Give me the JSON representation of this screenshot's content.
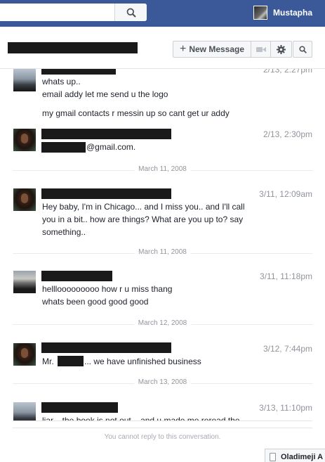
{
  "topbar": {
    "search_placeholder": "",
    "search_icon": "magnifier-icon",
    "user_name": "Mustapha",
    "color": "#3b5998"
  },
  "header": {
    "new_message_label": "New Message",
    "plus_glyph": "+",
    "video_icon": "video-camera-icon",
    "gear_icon": "gear-icon",
    "search_icon": "magnifier-icon"
  },
  "messages": [
    {
      "time": "2/13, 2:27pm",
      "lines": [
        "whats up..",
        "email addy let me send u the logo",
        "my gmail contacts r messin up so cant get ur addy"
      ]
    },
    {
      "time": "2/13, 2:30pm",
      "lines": [
        "@gmail.com."
      ]
    },
    {
      "divider": "March 11, 2008",
      "time": "3/11, 12:09am",
      "lines": [
        "Hey baby, I'm in Chicago... and I miss you.. and I'll call",
        "you in a bit.. how are things? What are you up to? say",
        "something.."
      ]
    },
    {
      "divider": "March 11, 2008",
      "time": "3/11, 11:18pm",
      "lines": [
        "helllooooooooo how r u  miss thang",
        "whats been good good good"
      ]
    },
    {
      "divider": "March 12, 2008",
      "time": "3/12, 7:44pm",
      "prefix": "Mr.",
      "suffix": "... we have unfinished business"
    },
    {
      "divider": "March 13, 2008",
      "time": "3/13, 11:10pm",
      "lines": [
        "liar... the book is not out... and u made me reread the"
      ]
    }
  ],
  "footer": {
    "notice": "You cannot reply to this conversation.",
    "chat_tab_name": "Oladimeji A"
  }
}
